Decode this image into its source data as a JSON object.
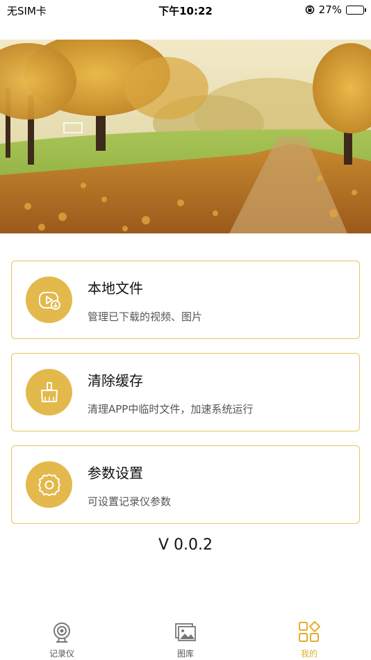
{
  "status_bar": {
    "carrier": "无SIM卡",
    "time": "下午10:22",
    "battery": "27%",
    "battery_level": 0.27
  },
  "hero": {
    "description_icon": "autumn-park-landscape"
  },
  "menu": [
    {
      "title": "本地文件",
      "subtitle": "管理已下载的视频、图片",
      "icon": "video-file-icon"
    },
    {
      "title": "清除缓存",
      "subtitle": "清理APP中临时文件，加速系统运行",
      "icon": "broom-icon"
    },
    {
      "title": "参数设置",
      "subtitle": "可设置记录仪参数",
      "icon": "gear-icon"
    }
  ],
  "version": "V 0.0.2",
  "tabs": [
    {
      "label": "记录仪",
      "icon": "camera-icon",
      "active": false
    },
    {
      "label": "图库",
      "icon": "gallery-icon",
      "active": false
    },
    {
      "label": "我的",
      "icon": "grid-icon",
      "active": true
    }
  ],
  "colors": {
    "accent": "#e3b94c",
    "border": "#e9c35b",
    "active_tab": "#e0ae2e"
  }
}
